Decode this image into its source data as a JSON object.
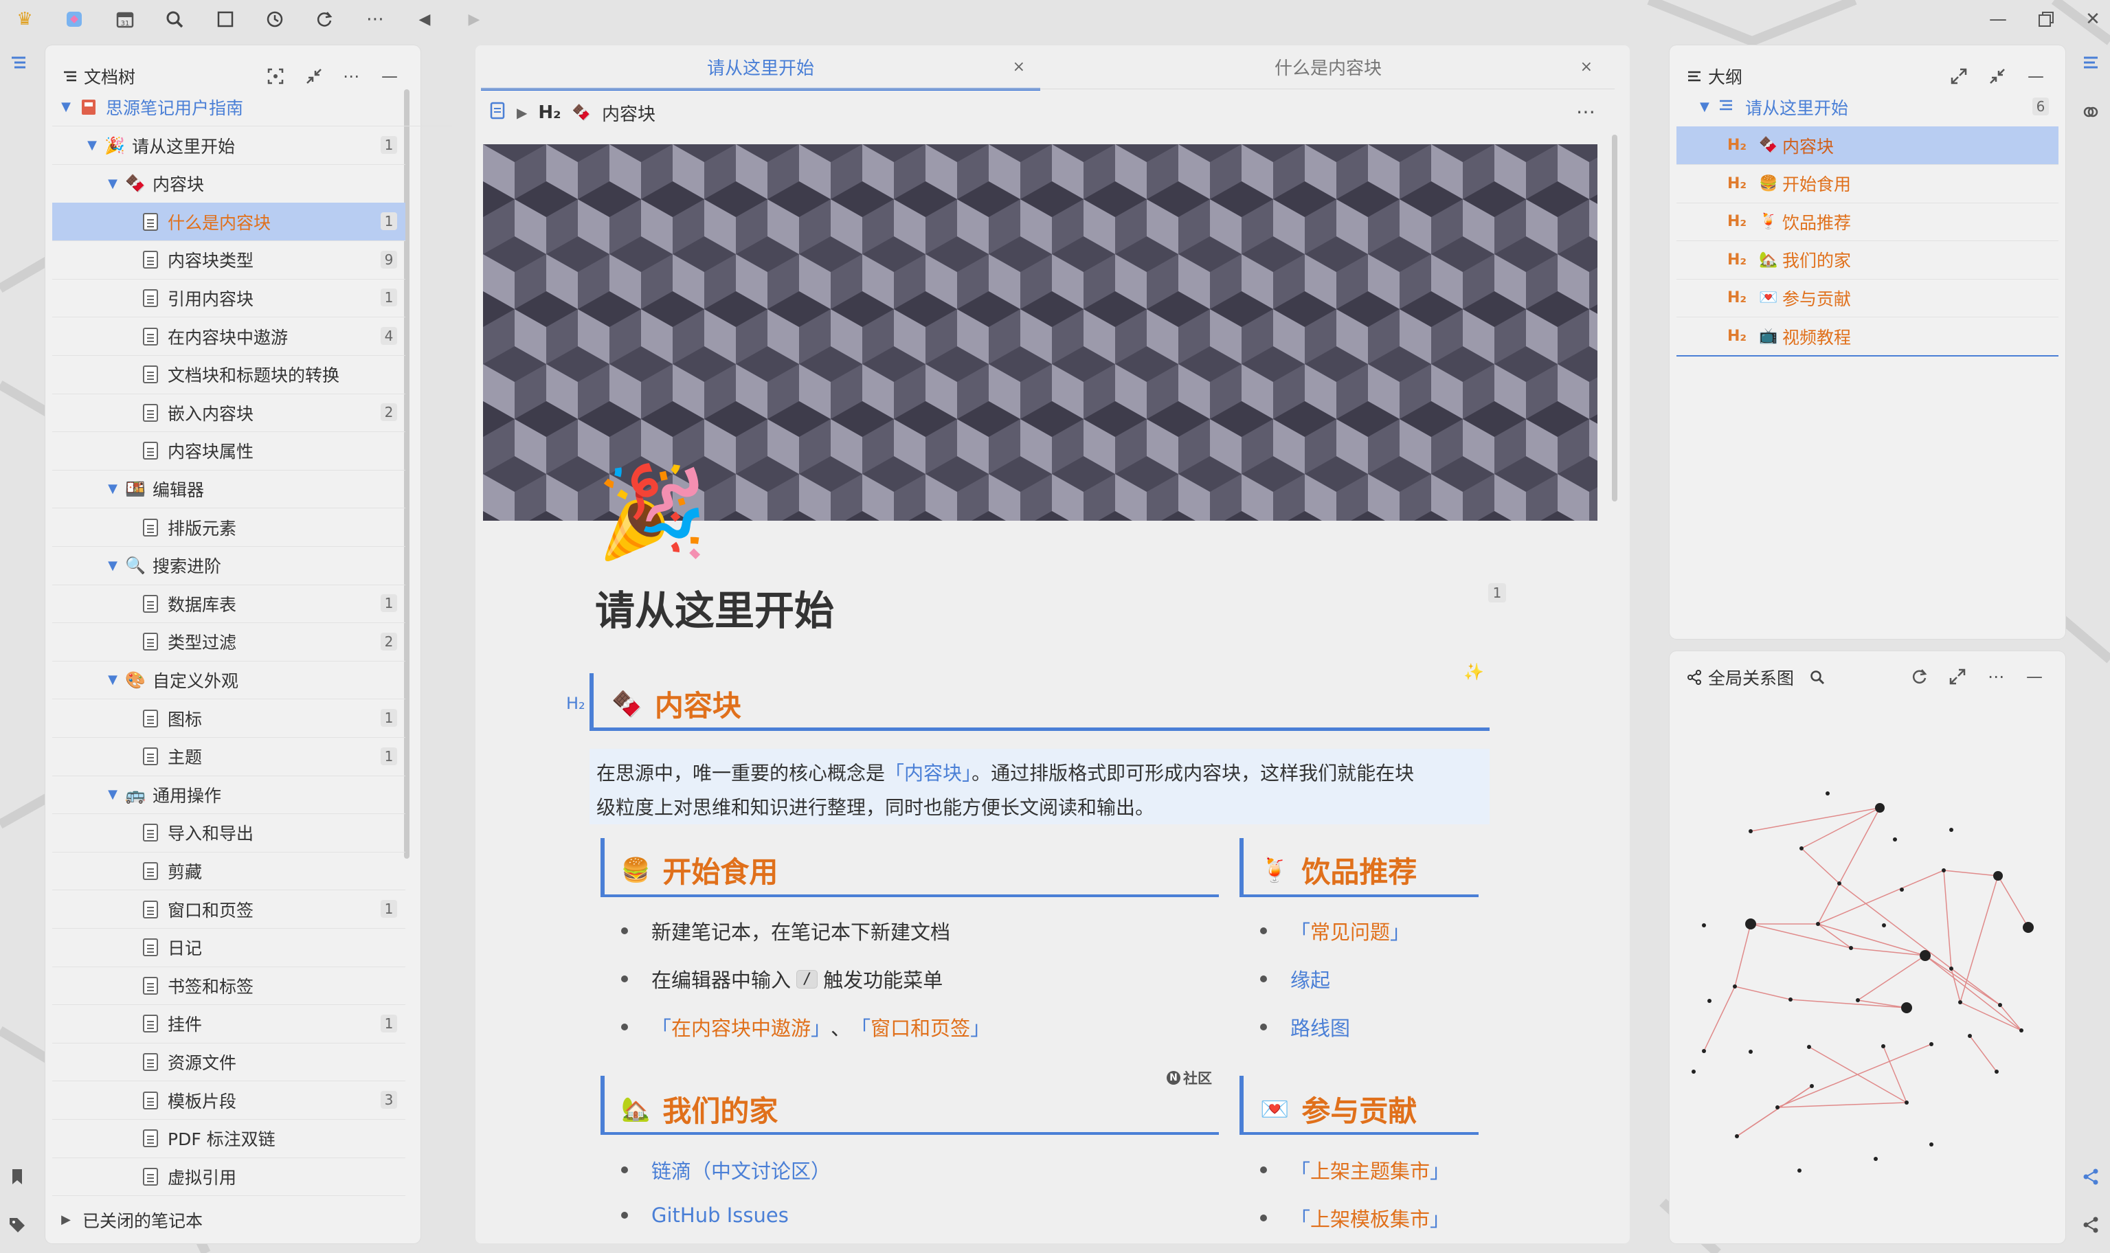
{
  "colors": {
    "accent": "#4a7fd6",
    "heading": "#e0701b",
    "selected": "#b8cdf2"
  },
  "doc_tree": {
    "title": "文档树",
    "notebook": "思源笔记用户指南",
    "items": [
      {
        "label": "请从这里开始",
        "badge": "1"
      },
      {
        "label": "内容块",
        "badge": ""
      },
      {
        "label": "什么是内容块",
        "badge": "1"
      },
      {
        "label": "内容块类型",
        "badge": "9"
      },
      {
        "label": "引用内容块",
        "badge": "1"
      },
      {
        "label": "在内容块中遨游",
        "badge": "4"
      },
      {
        "label": "文档块和标题块的转换",
        "badge": ""
      },
      {
        "label": "嵌入内容块",
        "badge": "2"
      },
      {
        "label": "内容块属性",
        "badge": ""
      },
      {
        "label": "编辑器",
        "badge": ""
      },
      {
        "label": "排版元素",
        "badge": ""
      },
      {
        "label": "搜索进阶",
        "badge": ""
      },
      {
        "label": "数据库表",
        "badge": "1"
      },
      {
        "label": "类型过滤",
        "badge": "2"
      },
      {
        "label": "自定义外观",
        "badge": ""
      },
      {
        "label": "图标",
        "badge": "1"
      },
      {
        "label": "主题",
        "badge": "1"
      },
      {
        "label": "通用操作",
        "badge": ""
      },
      {
        "label": "导入和导出",
        "badge": ""
      },
      {
        "label": "剪藏",
        "badge": ""
      },
      {
        "label": "窗口和页签",
        "badge": "1"
      },
      {
        "label": "日记",
        "badge": ""
      },
      {
        "label": "书签和标签",
        "badge": ""
      },
      {
        "label": "挂件",
        "badge": "1"
      },
      {
        "label": "资源文件",
        "badge": ""
      },
      {
        "label": "模板片段",
        "badge": "3"
      },
      {
        "label": "PDF 标注双链",
        "badge": ""
      },
      {
        "label": "虚拟引用",
        "badge": ""
      }
    ],
    "closed_notebooks": "已关闭的笔记本"
  },
  "editor": {
    "tabs": [
      {
        "label": "请从这里开始"
      },
      {
        "label": "什么是内容块"
      }
    ],
    "breadcrumb": {
      "heading_tag": "H₂",
      "label": "内容块"
    },
    "doc_title": "请从这里开始",
    "title_badge": "1",
    "h2_marker": "H₂",
    "section_heading": "内容块",
    "intro_line1_a": "在思源中，唯一重要的核心概念是",
    "intro_link": "内容块",
    "intro_line1_b": "。通过排版格式即可形成内容块，这样我们就能在块",
    "intro_line2": "级粒度上对思维和知识进行整理，同时也能方便长文阅读和输出。",
    "start": {
      "heading": "开始食用",
      "item1": "新建笔记本，在笔记本下新建文档",
      "item2_a": "在编辑器中输入",
      "item2_key": "/",
      "item2_b": "触发功能菜单",
      "item3_link1": "在内容块中遨游",
      "item3_sep": "、",
      "item3_link2": "窗口和页签"
    },
    "drinks": {
      "heading": "饮品推荐",
      "item1": "常见问题",
      "item2": "缘起",
      "item3": "路线图"
    },
    "home": {
      "heading": "我们的家",
      "community_tag": "社区",
      "item1": "链滴（中文讨论区）",
      "item2": "GitHub Issues"
    },
    "contribute": {
      "heading": "参与贡献",
      "item1": "上架主题集市",
      "item2": "上架模板集市"
    },
    "bracket_open": "「",
    "bracket_close": "」"
  },
  "outline": {
    "title": "大纲",
    "root": "请从这里开始",
    "root_badge": "6",
    "heading_tag": "H₂",
    "items": [
      {
        "label": "内容块"
      },
      {
        "label": "开始食用"
      },
      {
        "label": "饮品推荐"
      },
      {
        "label": "我们的家"
      },
      {
        "label": "参与贡献"
      },
      {
        "label": "视频教程"
      }
    ]
  },
  "graph": {
    "title": "全局关系图"
  }
}
